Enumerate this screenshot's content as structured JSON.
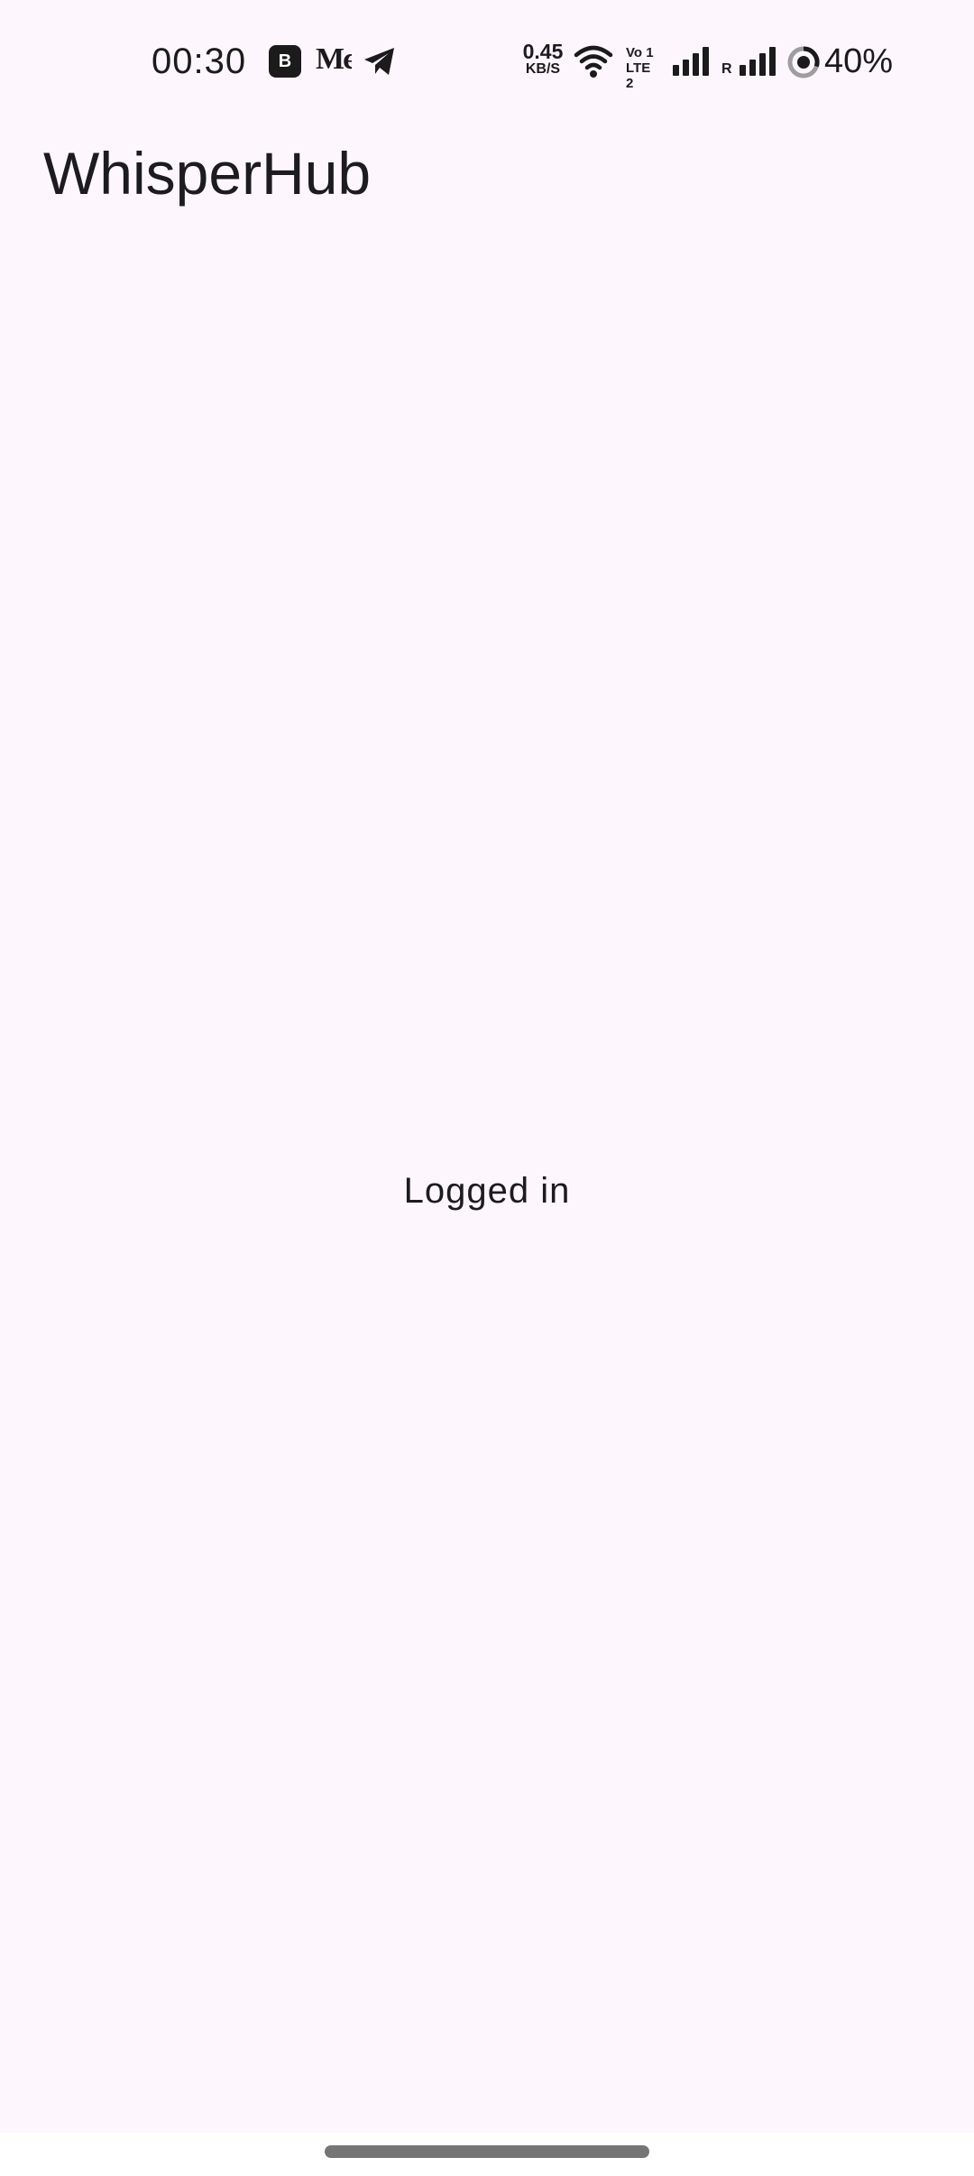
{
  "status_bar": {
    "time": "00:30",
    "notification_icons": [
      "b-app-icon",
      "medium-icon",
      "telegram-icon"
    ],
    "b_icon_letter": "B",
    "medium_icon_text": "Mє",
    "network_speed_value": "0.45",
    "network_speed_unit": "KB/S",
    "volte_line1": "Vo 1",
    "volte_line2": "LTE 2",
    "roaming_label": "R",
    "battery_percent": "40%"
  },
  "app_bar": {
    "title": "WhisperHub"
  },
  "main": {
    "status_message": "Logged in"
  },
  "colors": {
    "background": "#fdf7fd",
    "text": "#1c1b1f",
    "gesture_handle": "#757575"
  }
}
